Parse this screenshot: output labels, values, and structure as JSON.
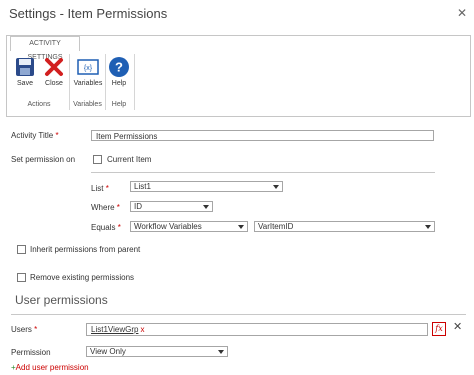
{
  "dialog": {
    "title": "Settings - Item Permissions"
  },
  "ribbon": {
    "tab": "ACTIVITY SETTINGS",
    "buttons": {
      "save": "Save",
      "close": "Close",
      "variables": "Variables",
      "help": "Help"
    },
    "groups": {
      "actions": "Actions",
      "variables": "Variables",
      "help": "Help"
    },
    "variables_icon_text": "{x}"
  },
  "form": {
    "activity_title_label": "Activity Title",
    "required_mark": "*",
    "activity_title_value": "Item Permissions",
    "set_permission_label": "Set permission on",
    "current_item_label": "Current Item",
    "list_label": "List",
    "list_value": "List1",
    "where_label": "Where",
    "where_value": "ID",
    "equals_label": "Equals",
    "equals_source": "Workflow Variables",
    "equals_value": "VarItemID",
    "inherit_label": "Inherit permissions from parent",
    "remove_label": "Remove existing permissions"
  },
  "user_permissions": {
    "section_title": "User permissions",
    "users_label": "Users",
    "users_token": "List1ViewGrp",
    "token_remove": "x",
    "fx_label": "fx",
    "remove_row": "✕",
    "permission_label": "Permission",
    "permission_value": "View Only",
    "add_link_plus": "+",
    "add_link_text": "Add user permission"
  },
  "colors": {
    "required": "#cc0000",
    "accent_blue": "#1f5fb4",
    "add_plus": "#2a8a2a"
  },
  "icons": [
    "save-icon",
    "close-icon",
    "variables-icon",
    "help-icon",
    "fx-icon",
    "remove-icon"
  ]
}
